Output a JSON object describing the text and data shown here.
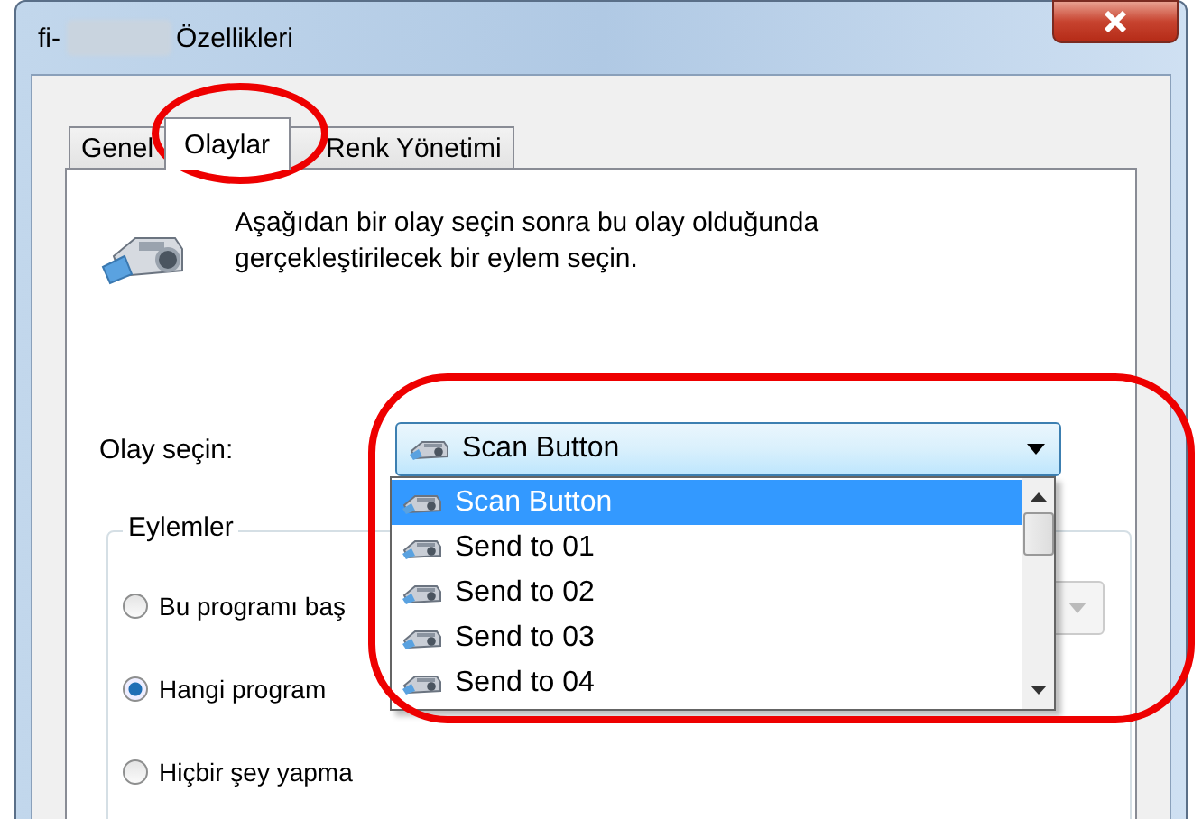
{
  "window": {
    "title_prefix": "fi-",
    "title_suffix": "Özellikleri"
  },
  "tabs": [
    {
      "label": "Genel",
      "selected": false
    },
    {
      "label": "Olaylar",
      "selected": true
    },
    {
      "label": "Renk Yönetimi",
      "selected": false
    }
  ],
  "description": "Aşağıdan bir olay seçin sonra bu olay olduğunda\ngerçekleştirilecek bir eylem seçin.",
  "event_label": "Olay seçin:",
  "event_combo": {
    "value": "Scan Button",
    "expanded": true
  },
  "event_list": [
    {
      "label": "Scan Button",
      "selected": true
    },
    {
      "label": "Send to 01",
      "selected": false
    },
    {
      "label": "Send to 02",
      "selected": false
    },
    {
      "label": "Send to 03",
      "selected": false
    },
    {
      "label": "Send to 04",
      "selected": false
    }
  ],
  "actions_group": {
    "title": "Eylemler",
    "options": [
      {
        "label": "Bu programı baş",
        "selected": false
      },
      {
        "label": "Hangi program",
        "selected": true
      },
      {
        "label": "Hiçbir şey yapma",
        "selected": false
      }
    ]
  }
}
